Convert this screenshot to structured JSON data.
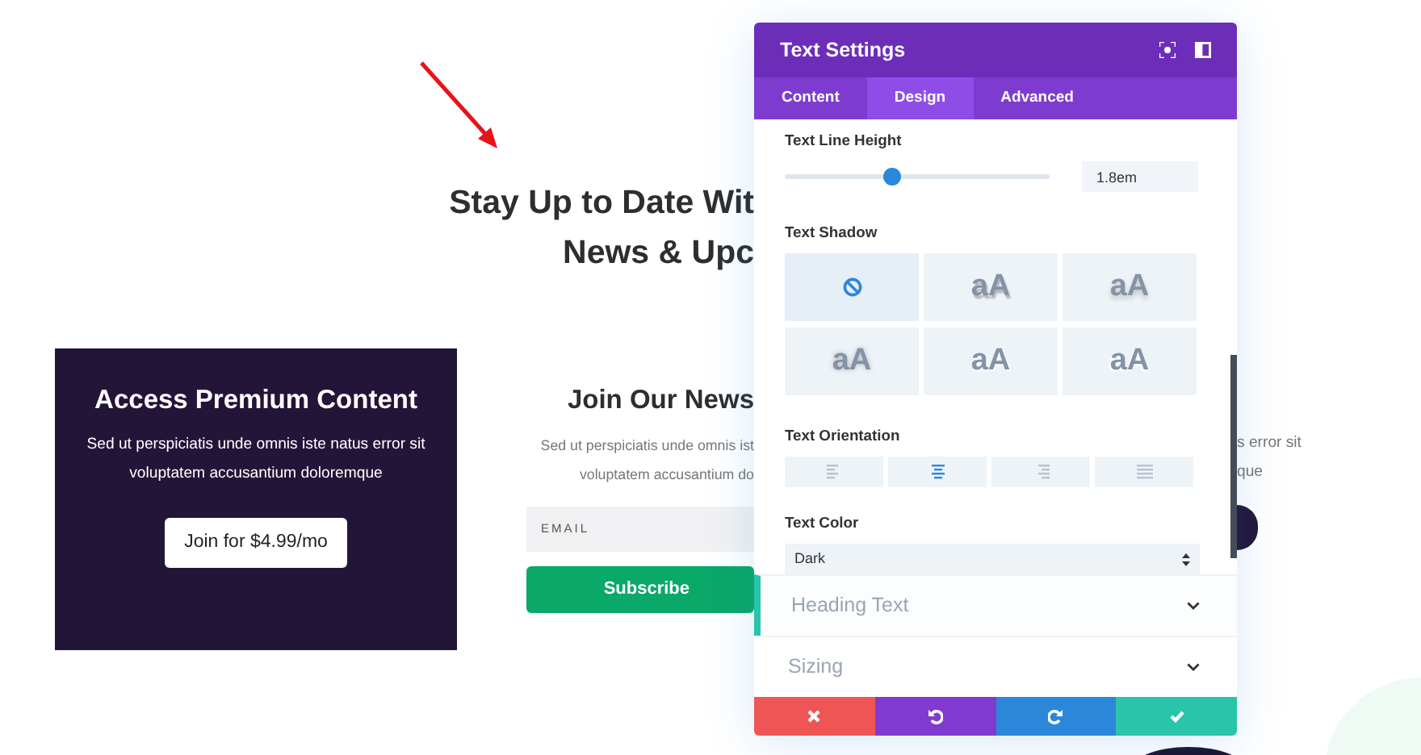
{
  "page": {
    "heading_lines": [
      "Stay Up to Date Wit",
      "News & Upc"
    ],
    "cards": [
      {
        "kind": "premium",
        "title": "Access Premium Content",
        "text_lines": [
          "Sed ut perspiciatis unde omnis iste natus error sit",
          "voluptatem accusantium doloremque"
        ],
        "button": "Join for $4.99/mo"
      },
      {
        "kind": "newsletter",
        "title": "Join Our News",
        "text_lines": [
          "Sed ut perspiciatis unde omnis ist",
          "voluptatem accusantium do"
        ],
        "email_placeholder": "EMAIL",
        "button": "Subscribe"
      },
      {
        "kind": "partial",
        "text_lines": [
          "s error sit",
          "que"
        ]
      }
    ]
  },
  "settings_panel": {
    "title": "Text Settings",
    "tabs": [
      {
        "label": "Content",
        "selected": false
      },
      {
        "label": "Design",
        "selected": true
      },
      {
        "label": "Advanced",
        "selected": false
      }
    ],
    "line_height": {
      "label": "Text Line Height",
      "level": 0.4,
      "value": "1.8em"
    },
    "text_shadow": {
      "label": "Text Shadow",
      "options": [
        {
          "kind": "none",
          "selected": true
        },
        {
          "kind": "preset",
          "text": "aA",
          "selected": false
        },
        {
          "kind": "preset",
          "text": "aA",
          "selected": false
        },
        {
          "kind": "preset",
          "text": "aA",
          "selected": false
        },
        {
          "kind": "preset",
          "text": "aA",
          "selected": false
        },
        {
          "kind": "preset",
          "text": "aA",
          "selected": false
        }
      ]
    },
    "text_orientation": {
      "label": "Text Orientation",
      "options": [
        {
          "kind": "left",
          "selected": false
        },
        {
          "kind": "center",
          "selected": true
        },
        {
          "kind": "right",
          "selected": false
        },
        {
          "kind": "justify",
          "selected": false
        }
      ]
    },
    "text_color": {
      "label": "Text Color",
      "value": "Dark"
    },
    "sections": [
      {
        "label": "Heading Text",
        "highlighted": true
      },
      {
        "label": "Sizing",
        "highlighted": false
      }
    ],
    "actions": [
      {
        "kind": "cancel"
      },
      {
        "kind": "undo"
      },
      {
        "kind": "redo"
      },
      {
        "kind": "save"
      }
    ]
  }
}
